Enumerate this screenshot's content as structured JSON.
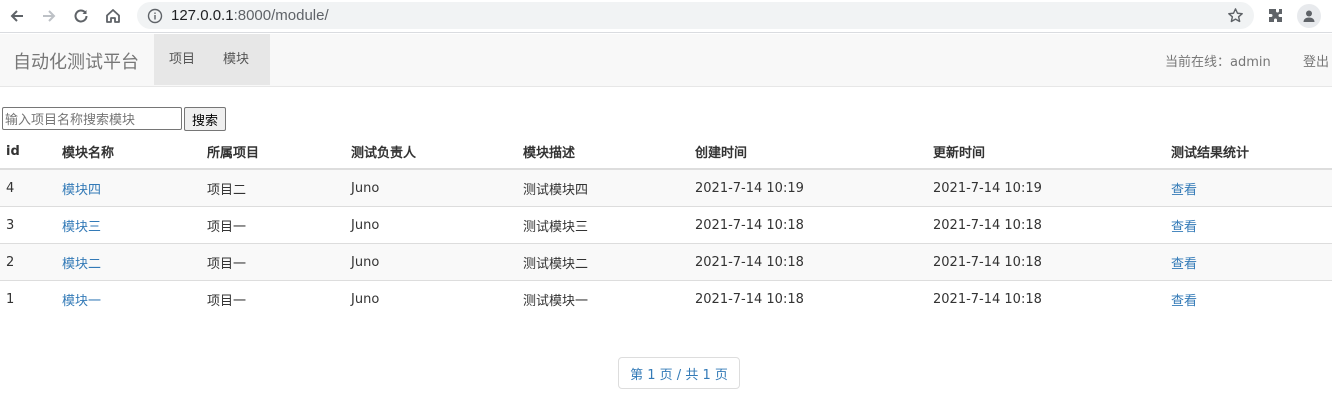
{
  "browser": {
    "url_host": "127.0.0.1",
    "url_path": ":8000/module/"
  },
  "navbar": {
    "brand": "自动化测试平台",
    "tabs": [
      {
        "label": "项目"
      },
      {
        "label": "模块"
      }
    ],
    "online_label": "当前在线：admin",
    "logout_label": "登出"
  },
  "search": {
    "placeholder": "输入项目名称搜索模块",
    "button_label": "搜索"
  },
  "table": {
    "headers": [
      "id",
      "模块名称",
      "所属项目",
      "测试负责人",
      "模块描述",
      "创建时间",
      "更新时间",
      "测试结果统计"
    ],
    "rows": [
      {
        "id": "4",
        "name": "模块四",
        "project": "项目二",
        "owner": "Juno",
        "desc": "测试模块四",
        "created": "2021-7-14 10:19",
        "updated": "2021-7-14 10:19",
        "stats": "查看"
      },
      {
        "id": "3",
        "name": "模块三",
        "project": "项目一",
        "owner": "Juno",
        "desc": "测试模块三",
        "created": "2021-7-14 10:18",
        "updated": "2021-7-14 10:18",
        "stats": "查看"
      },
      {
        "id": "2",
        "name": "模块二",
        "project": "项目一",
        "owner": "Juno",
        "desc": "测试模块二",
        "created": "2021-7-14 10:18",
        "updated": "2021-7-14 10:18",
        "stats": "查看"
      },
      {
        "id": "1",
        "name": "模块一",
        "project": "项目一",
        "owner": "Juno",
        "desc": "测试模块一",
        "created": "2021-7-14 10:18",
        "updated": "2021-7-14 10:18",
        "stats": "查看"
      }
    ]
  },
  "pagination": {
    "label": "第 1 页 / 共 1 页"
  },
  "colors": {
    "link": "#337ab7",
    "navbar_bg": "#f8f8f8",
    "active_tab_bg": "#e7e7e7"
  }
}
